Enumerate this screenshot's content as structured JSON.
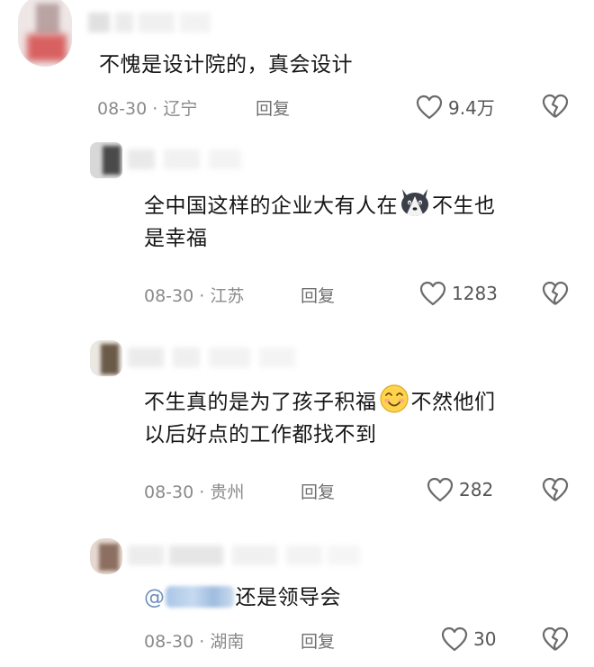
{
  "comments": [
    {
      "text_lines": [
        "不愧是设计院的，真会设计"
      ],
      "date": "08-30",
      "sep": "·",
      "location": "辽宁",
      "reply_label": "回复",
      "likes": "9.4万",
      "icons": {
        "like": "heart-outline-icon",
        "dislike": "broken-heart-icon"
      }
    },
    {
      "text_lines": [
        "全中国这样的企业大有人在",
        "不生也",
        "是幸福"
      ],
      "emoji": "husky-dog-emoji",
      "date": "08-30",
      "sep": "·",
      "location": "江苏",
      "reply_label": "回复",
      "likes": "1283"
    },
    {
      "text_lines": [
        "不生真的是为了孩子积福",
        "不然他们",
        "以后好点的工作都找不到"
      ],
      "emoji": "smiling-face-emoji",
      "date": "08-30",
      "sep": "·",
      "location": "贵州",
      "reply_label": "回复",
      "likes": "282"
    },
    {
      "mention_prefix": "@",
      "text_lines": [
        "还是领导会"
      ],
      "date": "08-30",
      "sep": "·",
      "location": "湖南",
      "reply_label": "回复",
      "likes": "30"
    }
  ],
  "colors": {
    "text": "#161616",
    "meta": "#8a8a8a",
    "icon": "#6b6b6b",
    "mention_blur": "#b5cde8"
  }
}
